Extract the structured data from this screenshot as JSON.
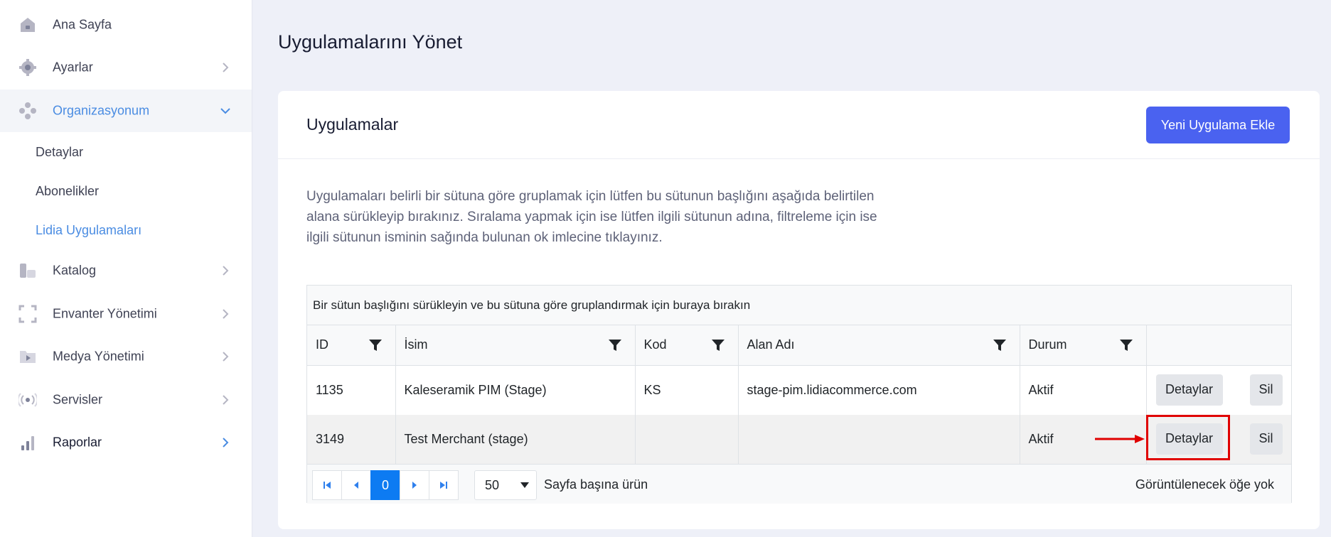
{
  "sidebar": {
    "items": [
      {
        "label": "Ana Sayfa",
        "icon": "home-icon"
      },
      {
        "label": "Ayarlar",
        "icon": "gear-icon"
      },
      {
        "label": "Organizasyonum",
        "icon": "organization-icon"
      },
      {
        "label": "Katalog",
        "icon": "catalog-icon"
      },
      {
        "label": "Envanter Yönetimi",
        "icon": "inventory-icon"
      },
      {
        "label": "Medya Yönetimi",
        "icon": "media-folder-icon"
      },
      {
        "label": "Servisler",
        "icon": "broadcast-icon"
      },
      {
        "label": "Raporlar",
        "icon": "bar-chart-icon"
      }
    ],
    "sub_items": [
      {
        "label": "Detaylar"
      },
      {
        "label": "Abonelikler"
      },
      {
        "label": "Lidia Uygulamaları"
      }
    ]
  },
  "page": {
    "title": "Uygulamalarını Yönet"
  },
  "card": {
    "title": "Uygulamalar",
    "add_button": "Yeni Uygulama Ekle",
    "description": "Uygulamaları belirli bir sütuna göre gruplamak için lütfen bu sütunun başlığını aşağıda belirtilen alana sürükleyip bırakınız. Sıralama yapmak için ise lütfen ilgili sütunun adına, filtreleme için ise ilgili sütunun isminin sağında bulunan ok imlecine tıklayınız."
  },
  "grid": {
    "group_panel": "Bir sütun başlığını sürükleyin ve bu sütuna göre gruplandırmak için buraya bırakın",
    "columns": [
      "ID",
      "İsim",
      "Kod",
      "Alan Adı",
      "Durum"
    ],
    "rows": [
      {
        "id": "1135",
        "name": "Kaleseramik PIM (Stage)",
        "code": "KS",
        "domain": "stage-pim.lidiacommerce.com",
        "status": "Aktif",
        "details": "Detaylar",
        "delete": "Sil"
      },
      {
        "id": "3149",
        "name": "Test Merchant (stage)",
        "code": "",
        "domain": "",
        "status": "Aktif",
        "details": "Detaylar",
        "delete": "Sil"
      }
    ],
    "pager": {
      "current_page": "0",
      "page_size": "50",
      "page_size_label": "Sayfa başına ürün",
      "info": "Görüntülenecek öğe yok"
    }
  },
  "colors": {
    "accent": "#4a8ce2",
    "primary_button": "#4a62f0",
    "highlight": "#e00000"
  }
}
